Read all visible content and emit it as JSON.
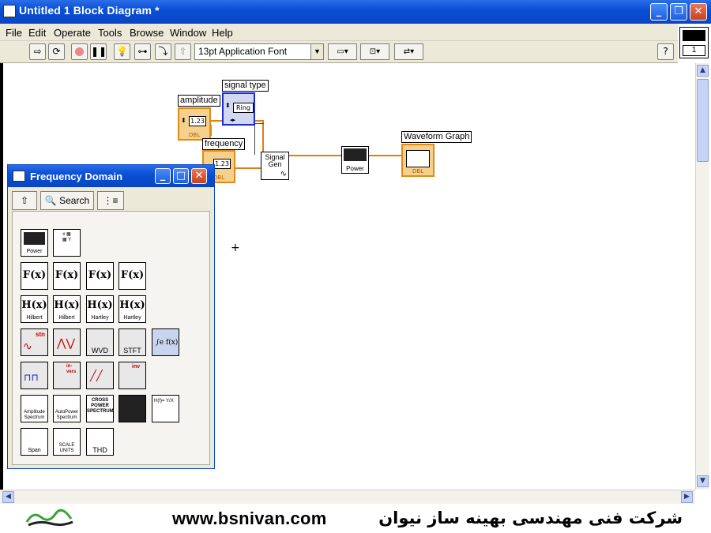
{
  "window": {
    "title": "Untitled 1 Block Diagram *"
  },
  "menu": [
    "File",
    "Edit",
    "Operate",
    "Tools",
    "Browse",
    "Window",
    "Help"
  ],
  "toolbar": {
    "font": "13pt Application Font",
    "help": "?"
  },
  "vi_icon": {
    "number": "1"
  },
  "diagram": {
    "controls": {
      "amplitude": {
        "label": "amplitude",
        "value": "1.23",
        "type": "DBL"
      },
      "signal_type": {
        "label": "signal type",
        "value": "Ring"
      },
      "frequency": {
        "label": "frequency",
        "value": "1.23",
        "type": "DBL"
      }
    },
    "nodes": {
      "signal_gen": "Signal Gen",
      "power": "Power",
      "waveform_graph": {
        "label": "Waveform Graph",
        "type": "DBL"
      }
    }
  },
  "palette": {
    "title": "Frequency Domain",
    "search": "Search",
    "items": {
      "r1": [
        "Power",
        ""
      ],
      "r2": [
        "F(x)",
        "F(x)",
        "F(x)",
        "F(x)"
      ],
      "r3": [
        {
          "glyph": "H(x)",
          "cap": "Hilbert"
        },
        {
          "glyph": "H(x)",
          "cap": "Hilbert"
        },
        {
          "glyph": "H(x)",
          "cap": "Hartley"
        },
        {
          "glyph": "H(x)",
          "cap": "Hartley"
        }
      ],
      "r4": [
        "stn",
        "",
        "WVD",
        "STFT",
        ""
      ],
      "r5": [
        "",
        "in- vers",
        "",
        "inv"
      ],
      "r6": [
        "Amplitude Spectrum",
        "AutoPower Spectrum",
        "CROSS POWER SPECTRUM",
        "",
        ""
      ],
      "r7": [
        "Span",
        "SCALE UNITS",
        "THD"
      ]
    }
  },
  "footer": {
    "url": "www.bsnivan.com",
    "company": "شرکت فنی مهندسی بهینه ساز نیوان"
  }
}
